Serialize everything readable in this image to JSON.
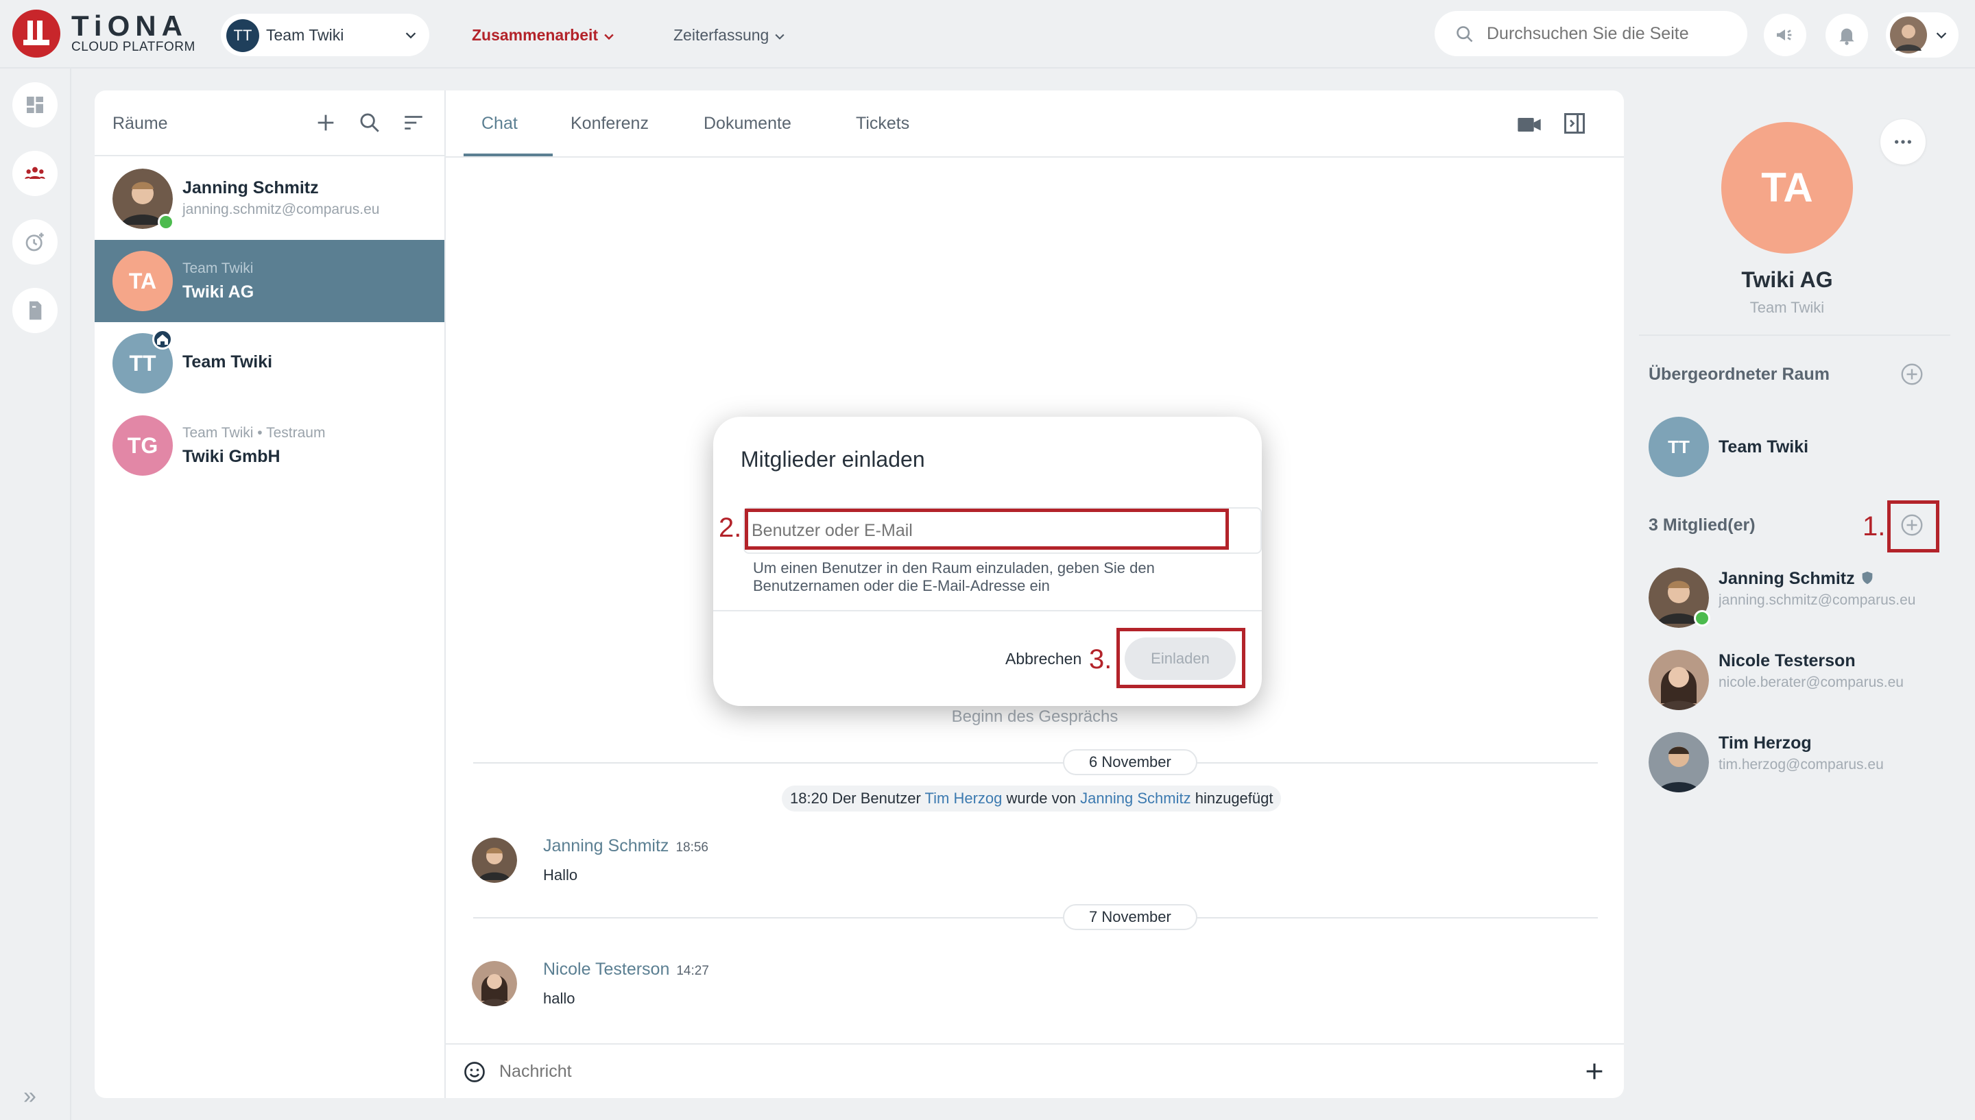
{
  "brand": {
    "name": "TiONA",
    "subtitle": "CLOUD PLATFORM",
    "color": "#c8262b"
  },
  "header": {
    "team_selector": {
      "avatar": "TT",
      "label": "Team Twiki"
    },
    "nav": [
      {
        "label": "Zusammenarbeit",
        "active": true
      },
      {
        "label": "Zeiterfassung",
        "active": false
      }
    ],
    "search": {
      "placeholder": "Durchsuchen Sie die Seite"
    },
    "icons": [
      "megaphone-icon",
      "bell-icon",
      "user-avatar"
    ]
  },
  "rail": {
    "items": [
      "dashboard-icon",
      "people-icon",
      "time-add-icon",
      "document-icon"
    ],
    "expand_glyph": "»"
  },
  "rooms": {
    "title": "Räume",
    "items": [
      {
        "subtitle": "",
        "name": "Janning Schmitz",
        "email": "janning.schmitz@comparus.eu",
        "online": true,
        "active": false
      },
      {
        "avatar": "TA",
        "subtitle": "Team Twiki",
        "name": "Twiki AG",
        "active": true,
        "color": "#f5a689"
      },
      {
        "avatar": "TT",
        "subtitle": "",
        "name": "Team Twiki",
        "active": false,
        "color": "#7ea3b7"
      },
      {
        "avatar": "TG",
        "subtitle": "Team Twiki • Testraum",
        "name": "Twiki GmbH",
        "active": false,
        "color": "#e287a6"
      }
    ]
  },
  "chat": {
    "tabs": [
      {
        "label": "Chat",
        "active": true
      },
      {
        "label": "Konferenz",
        "active": false
      },
      {
        "label": "Dokumente",
        "active": false
      },
      {
        "label": "Tickets",
        "active": false
      }
    ],
    "begin_text": "Beginn des Gesprächs",
    "dates": [
      "6 November",
      "7 November"
    ],
    "system_message": {
      "time": "18:20",
      "prefix": "Der Benutzer",
      "user": "Tim Herzog",
      "middle": "wurde von",
      "actor": "Janning Schmitz",
      "suffix": "hinzugefügt"
    },
    "messages": [
      {
        "author": "Janning Schmitz",
        "time": "18:56",
        "text": "Hallo"
      },
      {
        "author": "Nicole Testerson",
        "time": "14:27",
        "text": "hallo"
      }
    ],
    "composer_placeholder": "Nachricht"
  },
  "room_panel": {
    "avatar": "TA",
    "title": "Twiki AG",
    "subtitle": "Team Twiki",
    "parent_section": "Übergeordneter Raum",
    "parent_room": {
      "avatar": "TT",
      "name": "Team Twiki"
    },
    "members_label": "3 Mitglied(er)",
    "members": [
      {
        "name": "Janning Schmitz",
        "email": "janning.schmitz@comparus.eu",
        "admin": true,
        "online": true
      },
      {
        "name": "Nicole Testerson",
        "email": "nicole.berater@comparus.eu",
        "admin": false,
        "online": false
      },
      {
        "name": "Tim Herzog",
        "email": "tim.herzog@comparus.eu",
        "admin": false,
        "online": false
      }
    ]
  },
  "dialog": {
    "title": "Mitglieder einladen",
    "input_placeholder": "Benutzer oder E-Mail",
    "hint": "Um einen Benutzer in den Raum einzuladen, geben Sie den Benutzernamen oder die E-Mail-Adresse ein",
    "cancel_label": "Abbrechen",
    "invite_label": "Einladen"
  },
  "annotations": {
    "step1": "1.",
    "step2": "2.",
    "step3": "3.",
    "color": "#b3232a"
  }
}
